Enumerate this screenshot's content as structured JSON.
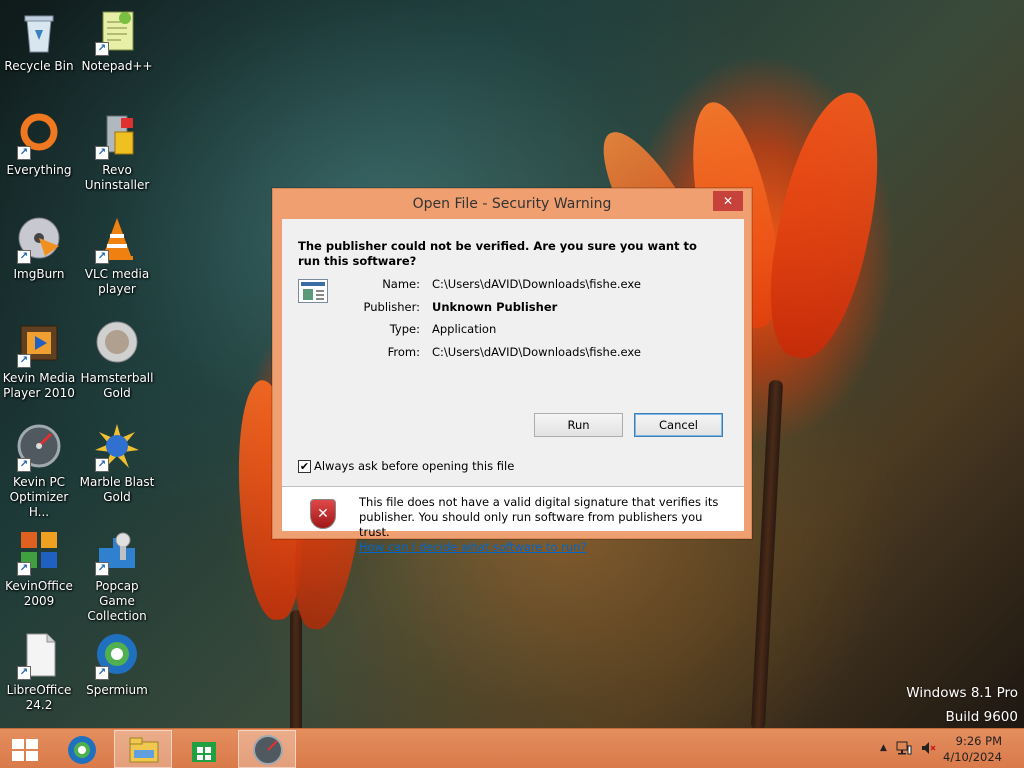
{
  "desktop": {
    "icons": [
      {
        "label": "Recycle Bin",
        "icon": "recycle-bin-icon"
      },
      {
        "label": "Notepad++",
        "icon": "notepad-plus-plus-icon"
      },
      {
        "label": "Everything",
        "icon": "everything-search-icon"
      },
      {
        "label": "Revo Uninstaller",
        "icon": "revo-uninstaller-icon"
      },
      {
        "label": "ImgBurn",
        "icon": "imgburn-disc-icon"
      },
      {
        "label": "VLC media player",
        "icon": "vlc-cone-icon"
      },
      {
        "label": "Kevin Media Player 2010",
        "icon": "media-player-film-icon"
      },
      {
        "label": "Hamsterball Gold",
        "icon": "hamsterball-icon"
      },
      {
        "label": "Kevin PC Optimizer H...",
        "icon": "pc-optimizer-gauge-icon"
      },
      {
        "label": "Marble Blast Gold",
        "icon": "marble-blast-icon"
      },
      {
        "label": "KevinOffice 2009",
        "icon": "office-icon"
      },
      {
        "label": "Popcap Game Collection",
        "icon": "puzzle-game-icon"
      },
      {
        "label": "LibreOffice 24.2",
        "icon": "libreoffice-document-icon"
      },
      {
        "label": "Spermium",
        "icon": "browser-globe-icon"
      }
    ]
  },
  "dialog": {
    "title": "Open File - Security Warning",
    "close_label": "✕",
    "heading": "The publisher could not be verified.  Are you sure you want to run this software?",
    "props": {
      "name_label": "Name:",
      "name_value": "C:\\Users\\dAVID\\Downloads\\fishe.exe",
      "publisher_label": "Publisher:",
      "publisher_value": "Unknown Publisher",
      "type_label": "Type:",
      "type_value": "Application",
      "from_label": "From:",
      "from_value": "C:\\Users\\dAVID\\Downloads\\fishe.exe"
    },
    "run_label": "Run",
    "cancel_label": "Cancel",
    "checkbox_label": "Always ask before opening this file",
    "checkbox_checked": true,
    "footer_text": "This file does not have a valid digital signature that verifies its publisher.  You should only run software from publishers you trust.",
    "footer_link": "How can I decide what software to run?"
  },
  "watermark": {
    "line1": "Windows 8.1 Pro",
    "line2": "Build 9600"
  },
  "taskbar": {
    "items": [
      {
        "icon": "start-windows-icon"
      },
      {
        "icon": "browser-globe-icon"
      },
      {
        "icon": "file-explorer-icon",
        "active": true
      },
      {
        "icon": "store-icon"
      },
      {
        "icon": "pc-optimizer-gauge-icon",
        "active": true
      }
    ],
    "clock_time": "9:26 PM",
    "clock_date": "4/10/2024"
  },
  "colors": {
    "taskbar": "#d97a4a",
    "dialog_frame": "#f09f70",
    "close_button": "#c7423b",
    "link": "#0066cc"
  }
}
